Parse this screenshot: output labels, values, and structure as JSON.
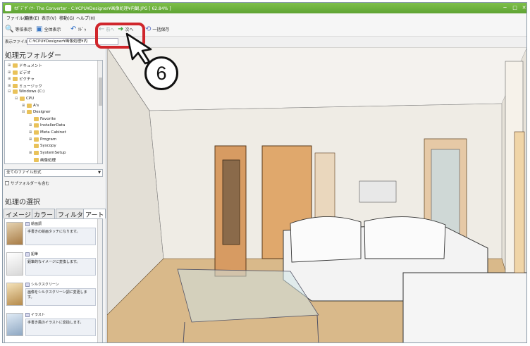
{
  "titlebar": {
    "title": "ｵｶﾞﾃﾞｻﾞｲﾅｰ The Converter - C:¥CPU¥Designer¥画像処理¥内観.JPG [ 62.84% ]"
  },
  "menu": [
    "ファイル(F)",
    "編集(E)",
    "表示(V)",
    "移動(G)",
    "ヘルプ(H)"
  ],
  "toolbar": {
    "actual_size": "等倍表示",
    "fit_all": "全体表示",
    "undo": "ﾘﾄﾞｩ",
    "back": "前へ",
    "next": "次へ",
    "save_all": "一括保存"
  },
  "pathbar": {
    "label": "表示ファイル名",
    "value": "C:¥CPU¥Designer¥画像処理¥内"
  },
  "folder_panel": {
    "title": "処理元フォルダー",
    "tree": [
      {
        "label": "ドキュメント",
        "level": 0,
        "exp": "⊞"
      },
      {
        "label": "ビデオ",
        "level": 0,
        "exp": "⊞"
      },
      {
        "label": "ピクチャ",
        "level": 0,
        "exp": "⊞"
      },
      {
        "label": "ミュージック",
        "level": 0,
        "exp": "⊞"
      },
      {
        "label": "Windows (C:)",
        "level": 0,
        "exp": "⊟"
      },
      {
        "label": "CPU",
        "level": 1,
        "exp": "⊟"
      },
      {
        "label": "A's",
        "level": 2,
        "exp": "⊞"
      },
      {
        "label": "Designer",
        "level": 2,
        "exp": "⊟"
      },
      {
        "label": "Favorite",
        "level": 3,
        "exp": ""
      },
      {
        "label": "InstallerData",
        "level": 3,
        "exp": "⊞"
      },
      {
        "label": "Meta Cabinet",
        "level": 3,
        "exp": "⊞"
      },
      {
        "label": "Program",
        "level": 3,
        "exp": "⊞"
      },
      {
        "label": "Syscopy",
        "level": 3,
        "exp": ""
      },
      {
        "label": "SystemSetup",
        "level": 3,
        "exp": "⊞"
      },
      {
        "label": "画像処理",
        "level": 3,
        "exp": ""
      }
    ],
    "filter_value": "全てのファイル形式",
    "include_subfolders": "サブフォルダーも含む"
  },
  "process_panel": {
    "title": "処理の選択",
    "tabs": [
      "イメージ",
      "カラー",
      "フィルター",
      "アート"
    ],
    "active_tab": "アート",
    "items": [
      {
        "name": "絵画調",
        "desc": "手書きの絵画タッチになります。",
        "style": ""
      },
      {
        "name": "鉛筆",
        "desc": "鉛筆的なイメージに変換します。",
        "style": "sketch"
      },
      {
        "name": "シルクスクリーン",
        "desc": "画像をシルクスクリーン調に変更します。",
        "style": "screen"
      },
      {
        "name": "イラスト",
        "desc": "手書き風のイラストに変換します。",
        "style": "illust"
      }
    ]
  },
  "callout": {
    "number": "6"
  },
  "colors": {
    "titlebar": "#6ab03d",
    "highlight": "#d0262c"
  }
}
